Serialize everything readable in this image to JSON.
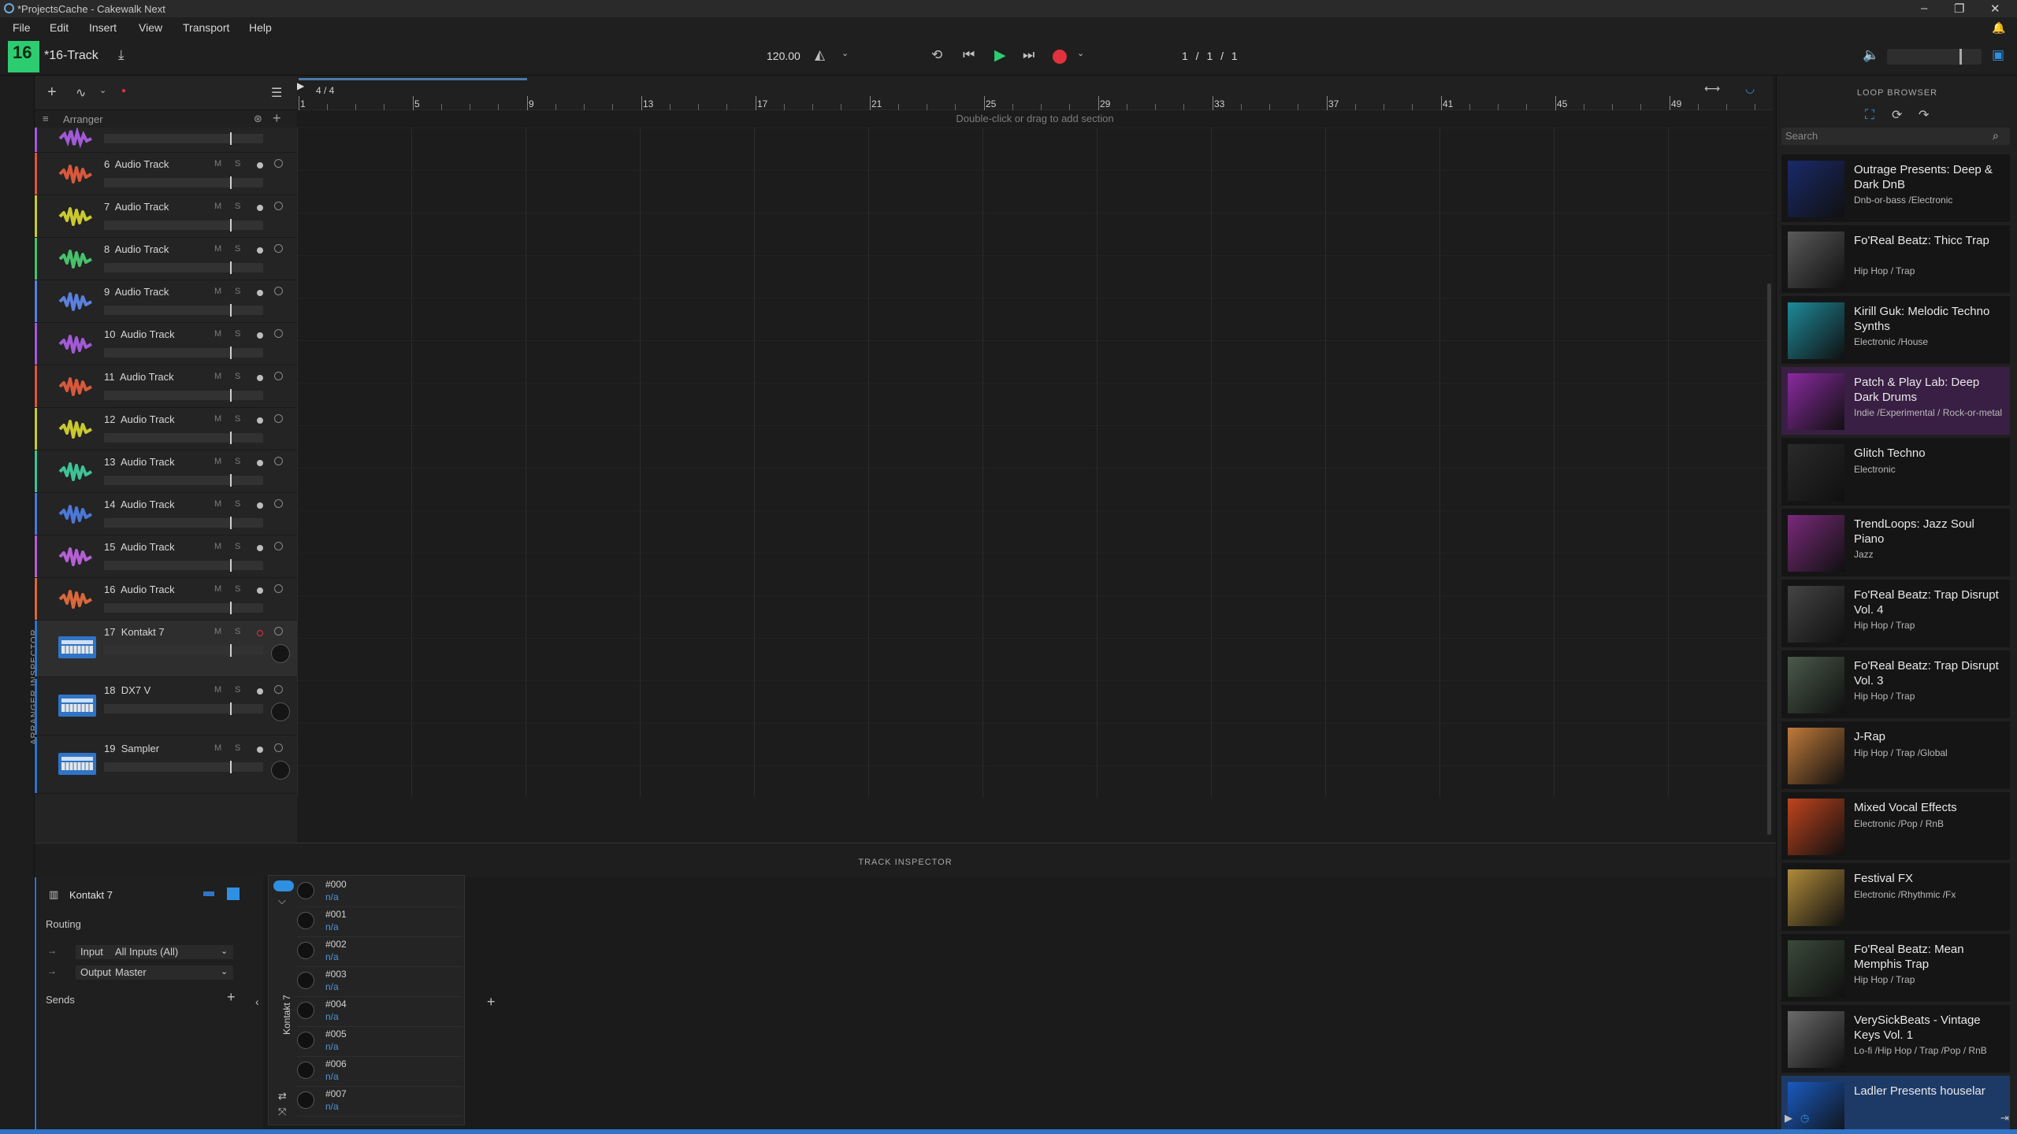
{
  "window": {
    "title": "*ProjectsCache - Cakewalk Next",
    "controls": [
      "–",
      "❐",
      "✕"
    ]
  },
  "menu": [
    "File",
    "Edit",
    "Insert",
    "View",
    "Transport",
    "Help"
  ],
  "toolbar": {
    "badge": "16",
    "project_name": "*16-Track",
    "tempo": "120.00",
    "position": "1 / 1 / 1"
  },
  "arranger": {
    "header_label": "Arranger",
    "time_signature": "4 / 4",
    "section_hint": "Double-click or drag to add section",
    "ruler": [
      "1",
      "5",
      "9",
      "13",
      "17",
      "21",
      "25",
      "29",
      "33",
      "37",
      "41",
      "45",
      "49"
    ]
  },
  "tracks": [
    {
      "num": "6",
      "name": "Audio Track",
      "color": "#d9583b"
    },
    {
      "num": "7",
      "name": "Audio Track",
      "color": "#c9c92f"
    },
    {
      "num": "8",
      "name": "Audio Track",
      "color": "#48c16b"
    },
    {
      "num": "9",
      "name": "Audio Track",
      "color": "#5b7fdc"
    },
    {
      "num": "10",
      "name": "Audio Track",
      "color": "#a25ad8"
    },
    {
      "num": "11",
      "name": "Audio Track",
      "color": "#d9583b"
    },
    {
      "num": "12",
      "name": "Audio Track",
      "color": "#c9c92f"
    },
    {
      "num": "13",
      "name": "Audio Track",
      "color": "#3fc196"
    },
    {
      "num": "14",
      "name": "Audio Track",
      "color": "#4b78d9"
    },
    {
      "num": "15",
      "name": "Audio Track",
      "color": "#b45fd4"
    },
    {
      "num": "16",
      "name": "Audio Track",
      "color": "#d9683b"
    }
  ],
  "instruments": [
    {
      "num": "17",
      "name": "Kontakt 7"
    },
    {
      "num": "18",
      "name": "DX7 V"
    },
    {
      "num": "19",
      "name": "Sampler"
    }
  ],
  "track_controls": {
    "mute": "M",
    "solo": "S"
  },
  "left_strip_label": "ARRANGER INSPECTOR",
  "inspector": {
    "bar_label": "TRACK INSPECTOR",
    "track_name": "Kontakt 7",
    "routing_label": "Routing",
    "input_label": "Input",
    "input_value": "All Inputs (All)",
    "output_label": "Output",
    "output_value": "Master",
    "sends_label": "Sends",
    "plugin_name": "Kontakt 7",
    "params": [
      {
        "name": "#000",
        "value": "n/a"
      },
      {
        "name": "#001",
        "value": "n/a"
      },
      {
        "name": "#002",
        "value": "n/a"
      },
      {
        "name": "#003",
        "value": "n/a"
      },
      {
        "name": "#004",
        "value": "n/a"
      },
      {
        "name": "#005",
        "value": "n/a"
      },
      {
        "name": "#006",
        "value": "n/a"
      },
      {
        "name": "#007",
        "value": "n/a"
      }
    ]
  },
  "loop_browser": {
    "title": "LOOP BROWSER",
    "search_placeholder": "Search",
    "items": [
      {
        "title": "Outrage Presents: Deep & Dark DnB",
        "genre": "Dnb-or-bass /Electronic",
        "art": "#1a2a6a"
      },
      {
        "title": "Fo'Real Beatz: Thicc Trap",
        "genre": "Hip Hop / Trap",
        "art": "#5a5a5a"
      },
      {
        "title": "Kirill Guk: Melodic Techno Synths",
        "genre": "Electronic /House",
        "art": "#1e8a9a"
      },
      {
        "title": "Patch & Play Lab: Deep Dark Drums",
        "genre": "Indie /Experimental / Rock-or-metal",
        "art": "#8a2aa0"
      },
      {
        "title": "Glitch Techno",
        "genre": "Electronic",
        "art": "#2a2a2a"
      },
      {
        "title": "TrendLoops: Jazz Soul Piano",
        "genre": "Jazz",
        "art": "#7a2a7a"
      },
      {
        "title": "Fo'Real Beatz: Trap Disrupt Vol. 4",
        "genre": "Hip Hop / Trap",
        "art": "#444444"
      },
      {
        "title": "Fo'Real Beatz: Trap Disrupt Vol. 3",
        "genre": "Hip Hop / Trap",
        "art": "#4a5a4a"
      },
      {
        "title": "J-Rap",
        "genre": "Hip Hop / Trap /Global",
        "art": "#c07a3a"
      },
      {
        "title": "Mixed Vocal Effects",
        "genre": "Electronic /Pop / RnB",
        "art": "#c0441e"
      },
      {
        "title": "Festival FX",
        "genre": "Electronic /Rhythmic /Fx",
        "art": "#b08a3a"
      },
      {
        "title": "Fo'Real Beatz: Mean Memphis Trap",
        "genre": "Hip Hop / Trap",
        "art": "#3a4a3a"
      },
      {
        "title": "VerySickBeats - Vintage Keys Vol. 1",
        "genre": "Lo-fi /Hip Hop / Trap /Pop / RnB",
        "art": "#6a6a6a"
      },
      {
        "title": "Ladler Presents houselar",
        "genre": "",
        "art": "#1a5ac0"
      }
    ]
  }
}
